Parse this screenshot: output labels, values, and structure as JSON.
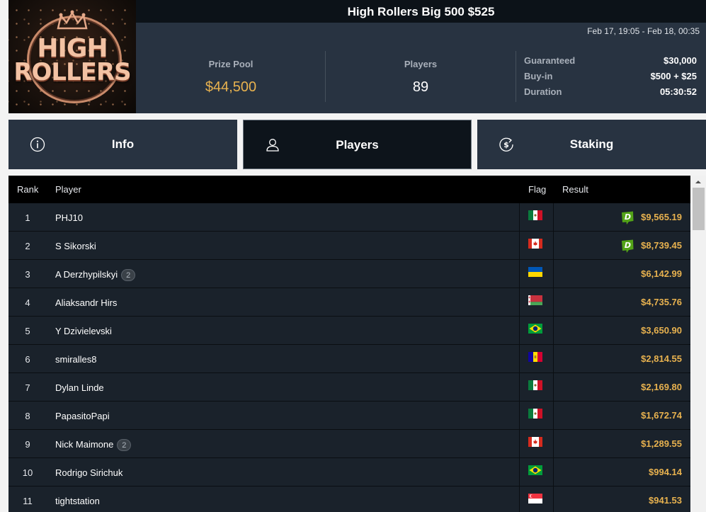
{
  "tournament": {
    "title": "High Rollers Big 500 $525",
    "dates": "Feb 17, 19:05 - Feb 18, 00:35",
    "logo_line1": "HIGH",
    "logo_line2": "ROLLERS"
  },
  "stats": {
    "prize_pool_label": "Prize Pool",
    "prize_pool_value": "$44,500",
    "players_label": "Players",
    "players_value": "89",
    "guaranteed_label": "Guaranteed",
    "guaranteed_value": "$30,000",
    "buyin_label": "Buy-in",
    "buyin_value": "$500 + $25",
    "duration_label": "Duration",
    "duration_value": "05:30:52"
  },
  "tabs": [
    {
      "label": "Info",
      "icon": "info-icon",
      "active": false
    },
    {
      "label": "Players",
      "icon": "user-icon",
      "active": true
    },
    {
      "label": "Staking",
      "icon": "dollar-refresh-icon",
      "active": false
    }
  ],
  "table": {
    "headers": {
      "rank": "Rank",
      "player": "Player",
      "flag": "Flag",
      "result": "Result"
    },
    "rows": [
      {
        "rank": "1",
        "player": "PHJ10",
        "badge": "",
        "flag": "mexico",
        "result": "$9,565.19",
        "dk": true
      },
      {
        "rank": "2",
        "player": "S Sikorski",
        "badge": "",
        "flag": "canada",
        "result": "$8,739.45",
        "dk": true
      },
      {
        "rank": "3",
        "player": "A Derzhypilskyi",
        "badge": "2",
        "flag": "ukraine",
        "result": "$6,142.99",
        "dk": false
      },
      {
        "rank": "4",
        "player": "Aliaksandr Hirs",
        "badge": "",
        "flag": "belarus",
        "result": "$4,735.76",
        "dk": false
      },
      {
        "rank": "5",
        "player": "Y Dzivielevski",
        "badge": "",
        "flag": "brazil",
        "result": "$3,650.90",
        "dk": false
      },
      {
        "rank": "6",
        "player": "smiralles8",
        "badge": "",
        "flag": "andorra",
        "result": "$2,814.55",
        "dk": false
      },
      {
        "rank": "7",
        "player": "Dylan Linde",
        "badge": "",
        "flag": "mexico",
        "result": "$2,169.80",
        "dk": false
      },
      {
        "rank": "8",
        "player": "PapasitoPapi",
        "badge": "",
        "flag": "mexico",
        "result": "$1,672.74",
        "dk": false
      },
      {
        "rank": "9",
        "player": "Nick Maimone",
        "badge": "2",
        "flag": "canada",
        "result": "$1,289.55",
        "dk": false
      },
      {
        "rank": "10",
        "player": "Rodrigo Sirichuk",
        "badge": "",
        "flag": "brazil",
        "result": "$994.14",
        "dk": false
      },
      {
        "rank": "11",
        "player": "tightstation",
        "badge": "",
        "flag": "singapore",
        "result": "$941.53",
        "dk": false
      }
    ]
  },
  "colors": {
    "gold": "#e8b24f",
    "panel": "#283341",
    "row": "#1a222b",
    "dk_green": "#53a318"
  }
}
